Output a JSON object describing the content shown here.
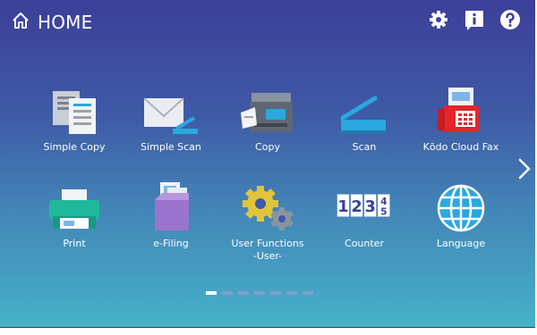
{
  "header": {
    "title": "HOME",
    "home_icon": "home-icon",
    "settings_icon": "gear-icon",
    "info_icon": "info-icon",
    "help_icon": "question-icon"
  },
  "apps": [
    {
      "label": "Simple Copy",
      "icon": "simple-copy-icon"
    },
    {
      "label": "Simple Scan",
      "icon": "simple-scan-icon"
    },
    {
      "label": "Copy",
      "icon": "copier-icon"
    },
    {
      "label": "Scan",
      "icon": "scanner-icon"
    },
    {
      "label": "Kōdo Cloud Fax",
      "icon": "fax-icon"
    },
    {
      "label": "Print",
      "icon": "printer-icon"
    },
    {
      "label": "e-Filing",
      "icon": "e-filing-icon"
    },
    {
      "label": "User Functions\n-User-",
      "icon": "gears-icon"
    },
    {
      "label": "Counter",
      "icon": "counter-icon"
    },
    {
      "label": "Language",
      "icon": "globe-icon"
    }
  ],
  "counter_digits": [
    "1",
    "2",
    "3",
    "4",
    "5"
  ],
  "pagination": {
    "pages": 7,
    "current": 1
  },
  "colors": {
    "background_top": "#3c3f99",
    "background_bottom": "#46b2c8",
    "accent": "#2aa8e0"
  }
}
